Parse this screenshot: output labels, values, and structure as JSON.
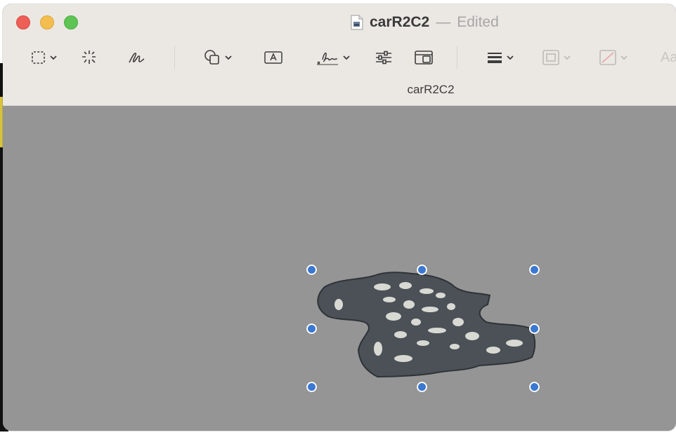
{
  "window": {
    "title": "carR2C2",
    "separator": "—",
    "status": "Edited",
    "subtitle": "carR2C2"
  },
  "toolbar": {
    "items": [
      {
        "name": "rectangular-selection-tool",
        "icon": "dashed-rect-icon",
        "has_menu": true
      },
      {
        "name": "instant-alpha-tool",
        "icon": "magic-wand-icon",
        "has_menu": false
      },
      {
        "name": "sketch-tool",
        "icon": "sketch-icon",
        "has_menu": false
      },
      {
        "name": "shapes-tool",
        "icon": "shapes-icon",
        "has_menu": true
      },
      {
        "name": "text-tool",
        "icon": "text-box-icon",
        "has_menu": false
      },
      {
        "name": "sign-tool",
        "icon": "signature-icon",
        "has_menu": true
      },
      {
        "name": "adjust-color-tool",
        "icon": "sliders-icon",
        "has_menu": false
      },
      {
        "name": "adjust-size-tool",
        "icon": "resize-icon",
        "has_menu": false
      },
      {
        "name": "shape-style-tool",
        "icon": "line-weight-icon",
        "has_menu": true
      },
      {
        "name": "border-color-tool",
        "icon": "border-color-icon",
        "has_menu": true
      },
      {
        "name": "fill-color-tool",
        "icon": "fill-color-icon",
        "has_menu": true
      },
      {
        "name": "text-style-tool",
        "icon": "text-style-icon",
        "has_menu": false
      }
    ],
    "text_style_label": "Aa"
  },
  "colors": {
    "titlebar": "#ebe8e4",
    "canvas": "#959595",
    "handle": "#3b78d1",
    "close": "#ed5f57",
    "minimize": "#f3be4f",
    "maximize": "#5ec454"
  },
  "image": {
    "subject": "cutout-object",
    "selected": true
  }
}
